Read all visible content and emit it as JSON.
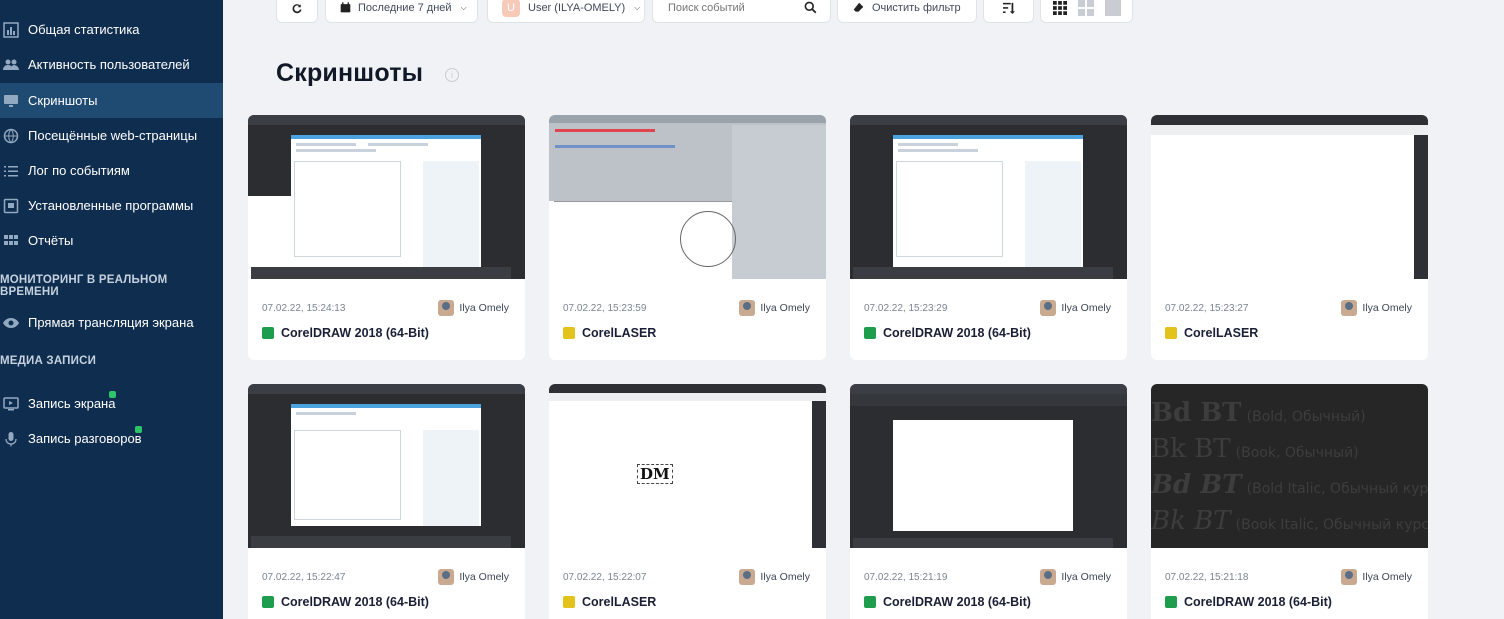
{
  "sidebar": {
    "items": [
      {
        "label": "Общая статистика",
        "icon": "chart-bars-icon",
        "active": false
      },
      {
        "label": "Активность пользователей",
        "icon": "users-icon",
        "active": false
      },
      {
        "label": "Скриншоты",
        "icon": "monitor-icon",
        "active": true
      },
      {
        "label": "Посещённые web-страницы",
        "icon": "globe-icon",
        "active": false
      },
      {
        "label": "Лог по событиям",
        "icon": "list-icon",
        "active": false
      },
      {
        "label": "Установленные программы",
        "icon": "installed-apps-icon",
        "active": false
      },
      {
        "label": "Отчёты",
        "icon": "grid-icon",
        "active": false
      }
    ],
    "section_realtime": "МОНИТОРИНГ В РЕАЛЬНОМ ВРЕМЕНИ",
    "realtime_items": [
      {
        "label": "Прямая трансляция экрана",
        "icon": "eye-icon"
      }
    ],
    "section_media": "МЕДИА ЗАПИСИ",
    "media_items": [
      {
        "label": "Запись экрана",
        "icon": "screen-record-icon",
        "locked": true
      },
      {
        "label": "Запись разговоров",
        "icon": "microphone-icon",
        "locked": true
      }
    ]
  },
  "toolbar": {
    "period_label": "Последние 7 дней",
    "user_initial": "U",
    "user_label": "User (ILYA-OMELY)",
    "search_placeholder": "Поиск событий",
    "clear_filter_label": "Очистить фильтр"
  },
  "page": {
    "title": "Скриншоты"
  },
  "screenshots": [
    {
      "date": "07.02.22, 15:24:13",
      "user": "Ilya Omely",
      "app": "CorelDRAW 2018 (64-Bit)",
      "app_type": "draw"
    },
    {
      "date": "07.02.22, 15:23:59",
      "user": "Ilya Omely",
      "app": "CorelLASER",
      "app_type": "laser"
    },
    {
      "date": "07.02.22, 15:23:29",
      "user": "Ilya Omely",
      "app": "CorelDRAW 2018 (64-Bit)",
      "app_type": "draw"
    },
    {
      "date": "07.02.22, 15:23:27",
      "user": "Ilya Omely",
      "app": "CorelLASER",
      "app_type": "laser"
    },
    {
      "date": "07.02.22, 15:22:47",
      "user": "Ilya Omely",
      "app": "CorelDRAW 2018 (64-Bit)",
      "app_type": "draw"
    },
    {
      "date": "07.02.22, 15:22:07",
      "user": "Ilya Omely",
      "app": "CorelLASER",
      "app_type": "laser"
    },
    {
      "date": "07.02.22, 15:21:19",
      "user": "Ilya Omely",
      "app": "CorelDRAW 2018 (64-Bit)",
      "app_type": "draw"
    },
    {
      "date": "07.02.22, 15:21:18",
      "user": "Ilya Omely",
      "app": "CorelDRAW 2018 (64-Bit)",
      "app_type": "draw"
    }
  ],
  "thumb_texts": {
    "dm_logo": "DM",
    "font_list": [
      {
        "name": "Bd BT",
        "style": "(Bold, Обычный)"
      },
      {
        "name": "Bk BT",
        "style": "(Book, Обычный)"
      },
      {
        "name": "Bd BT",
        "style": "(Bold Italic, Обычный кур"
      },
      {
        "name": "Bk BT",
        "style": "(Book Italic, Обычный курс"
      }
    ]
  }
}
